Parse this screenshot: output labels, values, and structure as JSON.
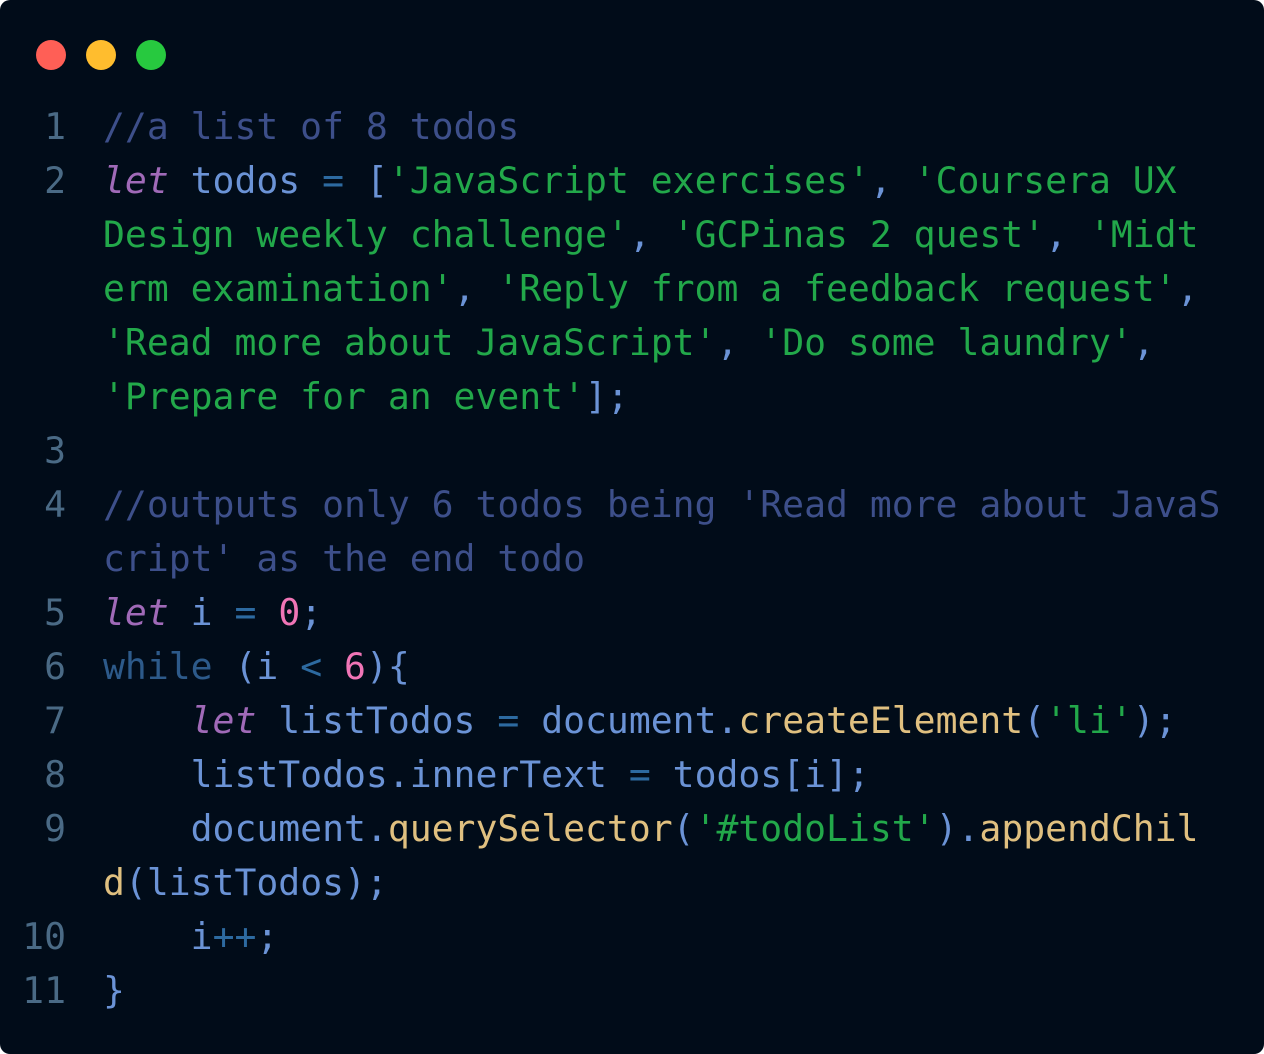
{
  "window": {
    "dots": [
      {
        "name": "close",
        "color": "#ff5f56"
      },
      {
        "name": "minimize",
        "color": "#ffbd2e"
      },
      {
        "name": "maximize",
        "color": "#27c93f"
      }
    ]
  },
  "colors": {
    "background": "#010c19",
    "comment": "#3d4f8a",
    "keyword": "#a06ab8",
    "identifier": "#6b93d6",
    "string": "#22a84a",
    "number": "#f075b6",
    "control": "#2d5a8a",
    "method": "#e0c080",
    "operator": "#2d6aa0",
    "line_number": "#4a6a85"
  },
  "lines": [
    {
      "n": "1",
      "tokens": [
        {
          "t": "//a list of 8 todos",
          "c": "comment"
        }
      ]
    },
    {
      "n": "2",
      "tokens": [
        {
          "t": "let",
          "c": "keyword"
        },
        {
          "t": " todos ",
          "c": "identifier"
        },
        {
          "t": "=",
          "c": "operator"
        },
        {
          "t": " [",
          "c": "identifier"
        },
        {
          "t": "'JavaScript exercises'",
          "c": "string"
        },
        {
          "t": ", ",
          "c": "identifier"
        },
        {
          "t": "'Coursera UX Design weekly challenge'",
          "c": "string"
        },
        {
          "t": ", ",
          "c": "identifier"
        },
        {
          "t": "'GCPinas 2 quest'",
          "c": "string"
        },
        {
          "t": ", ",
          "c": "identifier"
        },
        {
          "t": "'Midterm examination'",
          "c": "string"
        },
        {
          "t": ", ",
          "c": "identifier"
        },
        {
          "t": "'Reply from a feedback request'",
          "c": "string"
        },
        {
          "t": ", ",
          "c": "identifier"
        },
        {
          "t": "'Read more about JavaScript'",
          "c": "string"
        },
        {
          "t": ", ",
          "c": "identifier"
        },
        {
          "t": "'Do some laundry'",
          "c": "string"
        },
        {
          "t": ", ",
          "c": "identifier"
        },
        {
          "t": "'Prepare for an event'",
          "c": "string"
        },
        {
          "t": "];",
          "c": "identifier"
        }
      ]
    },
    {
      "n": "3",
      "tokens": []
    },
    {
      "n": "4",
      "tokens": [
        {
          "t": "//outputs only 6 todos being 'Read more about JavaScript' as the end todo",
          "c": "comment"
        }
      ]
    },
    {
      "n": "5",
      "tokens": [
        {
          "t": "let",
          "c": "keyword"
        },
        {
          "t": " i ",
          "c": "identifier"
        },
        {
          "t": "=",
          "c": "operator"
        },
        {
          "t": " ",
          "c": "identifier"
        },
        {
          "t": "0",
          "c": "number"
        },
        {
          "t": ";",
          "c": "identifier"
        }
      ]
    },
    {
      "n": "6",
      "tokens": [
        {
          "t": "while",
          "c": "control"
        },
        {
          "t": " (i ",
          "c": "identifier"
        },
        {
          "t": "<",
          "c": "operator"
        },
        {
          "t": " ",
          "c": "identifier"
        },
        {
          "t": "6",
          "c": "number"
        },
        {
          "t": "){",
          "c": "identifier"
        }
      ]
    },
    {
      "n": "7",
      "tokens": [
        {
          "t": "    ",
          "c": "identifier"
        },
        {
          "t": "let",
          "c": "keyword"
        },
        {
          "t": " listTodos ",
          "c": "identifier"
        },
        {
          "t": "=",
          "c": "operator"
        },
        {
          "t": " document.",
          "c": "identifier"
        },
        {
          "t": "createElement",
          "c": "method"
        },
        {
          "t": "(",
          "c": "identifier"
        },
        {
          "t": "'li'",
          "c": "string"
        },
        {
          "t": ");",
          "c": "identifier"
        }
      ]
    },
    {
      "n": "8",
      "tokens": [
        {
          "t": "    listTodos.innerText ",
          "c": "identifier"
        },
        {
          "t": "=",
          "c": "operator"
        },
        {
          "t": " todos[i];",
          "c": "identifier"
        }
      ]
    },
    {
      "n": "9",
      "tokens": [
        {
          "t": "    document.",
          "c": "identifier"
        },
        {
          "t": "querySelector",
          "c": "method"
        },
        {
          "t": "(",
          "c": "identifier"
        },
        {
          "t": "'#todoList'",
          "c": "string"
        },
        {
          "t": ").",
          "c": "identifier"
        },
        {
          "t": "appendChild",
          "c": "method"
        },
        {
          "t": "(listTodos);",
          "c": "identifier"
        }
      ]
    },
    {
      "n": "10",
      "tokens": [
        {
          "t": "    i",
          "c": "identifier"
        },
        {
          "t": "++",
          "c": "operator"
        },
        {
          "t": ";",
          "c": "identifier"
        }
      ]
    },
    {
      "n": "11",
      "tokens": [
        {
          "t": "}",
          "c": "identifier"
        }
      ]
    }
  ]
}
